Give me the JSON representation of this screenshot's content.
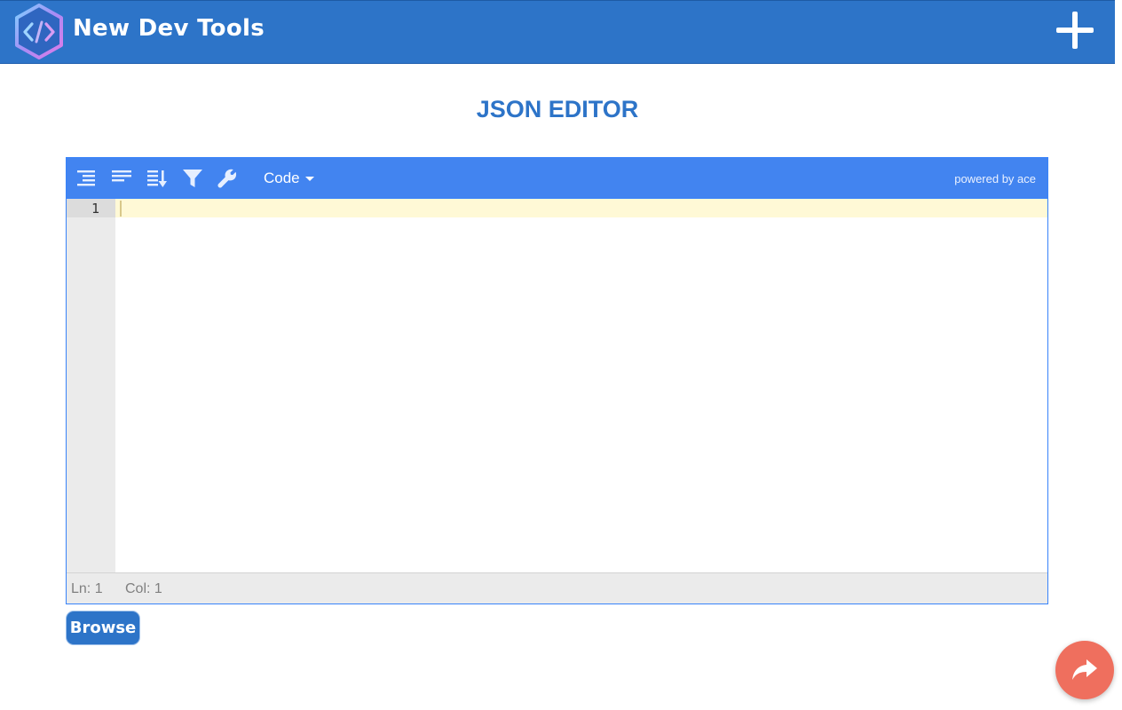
{
  "header": {
    "brand": "New Dev Tools",
    "logo_icon": "code-brackets-hexagon-icon",
    "add_icon": "plus-icon"
  },
  "page": {
    "title": "JSON EDITOR"
  },
  "editor": {
    "toolbar": {
      "icons": [
        "format-icon",
        "compact-icon",
        "sort-icon",
        "filter-icon",
        "wrench-icon"
      ],
      "mode_label": "Code",
      "powered_by": "powered by ace"
    },
    "gutter": {
      "line_numbers": [
        "1"
      ]
    },
    "content": "",
    "status": {
      "ln": "Ln: 1",
      "col": "Col: 1"
    }
  },
  "actions": {
    "browse_label": "Browse",
    "share_icon": "share-arrow-icon"
  },
  "colors": {
    "header_bg": "#2d74c8",
    "toolbar_bg": "#4284f0",
    "title": "#2d74c8",
    "share_fab": "#ef6f5e",
    "active_line": "#fff9d6"
  }
}
